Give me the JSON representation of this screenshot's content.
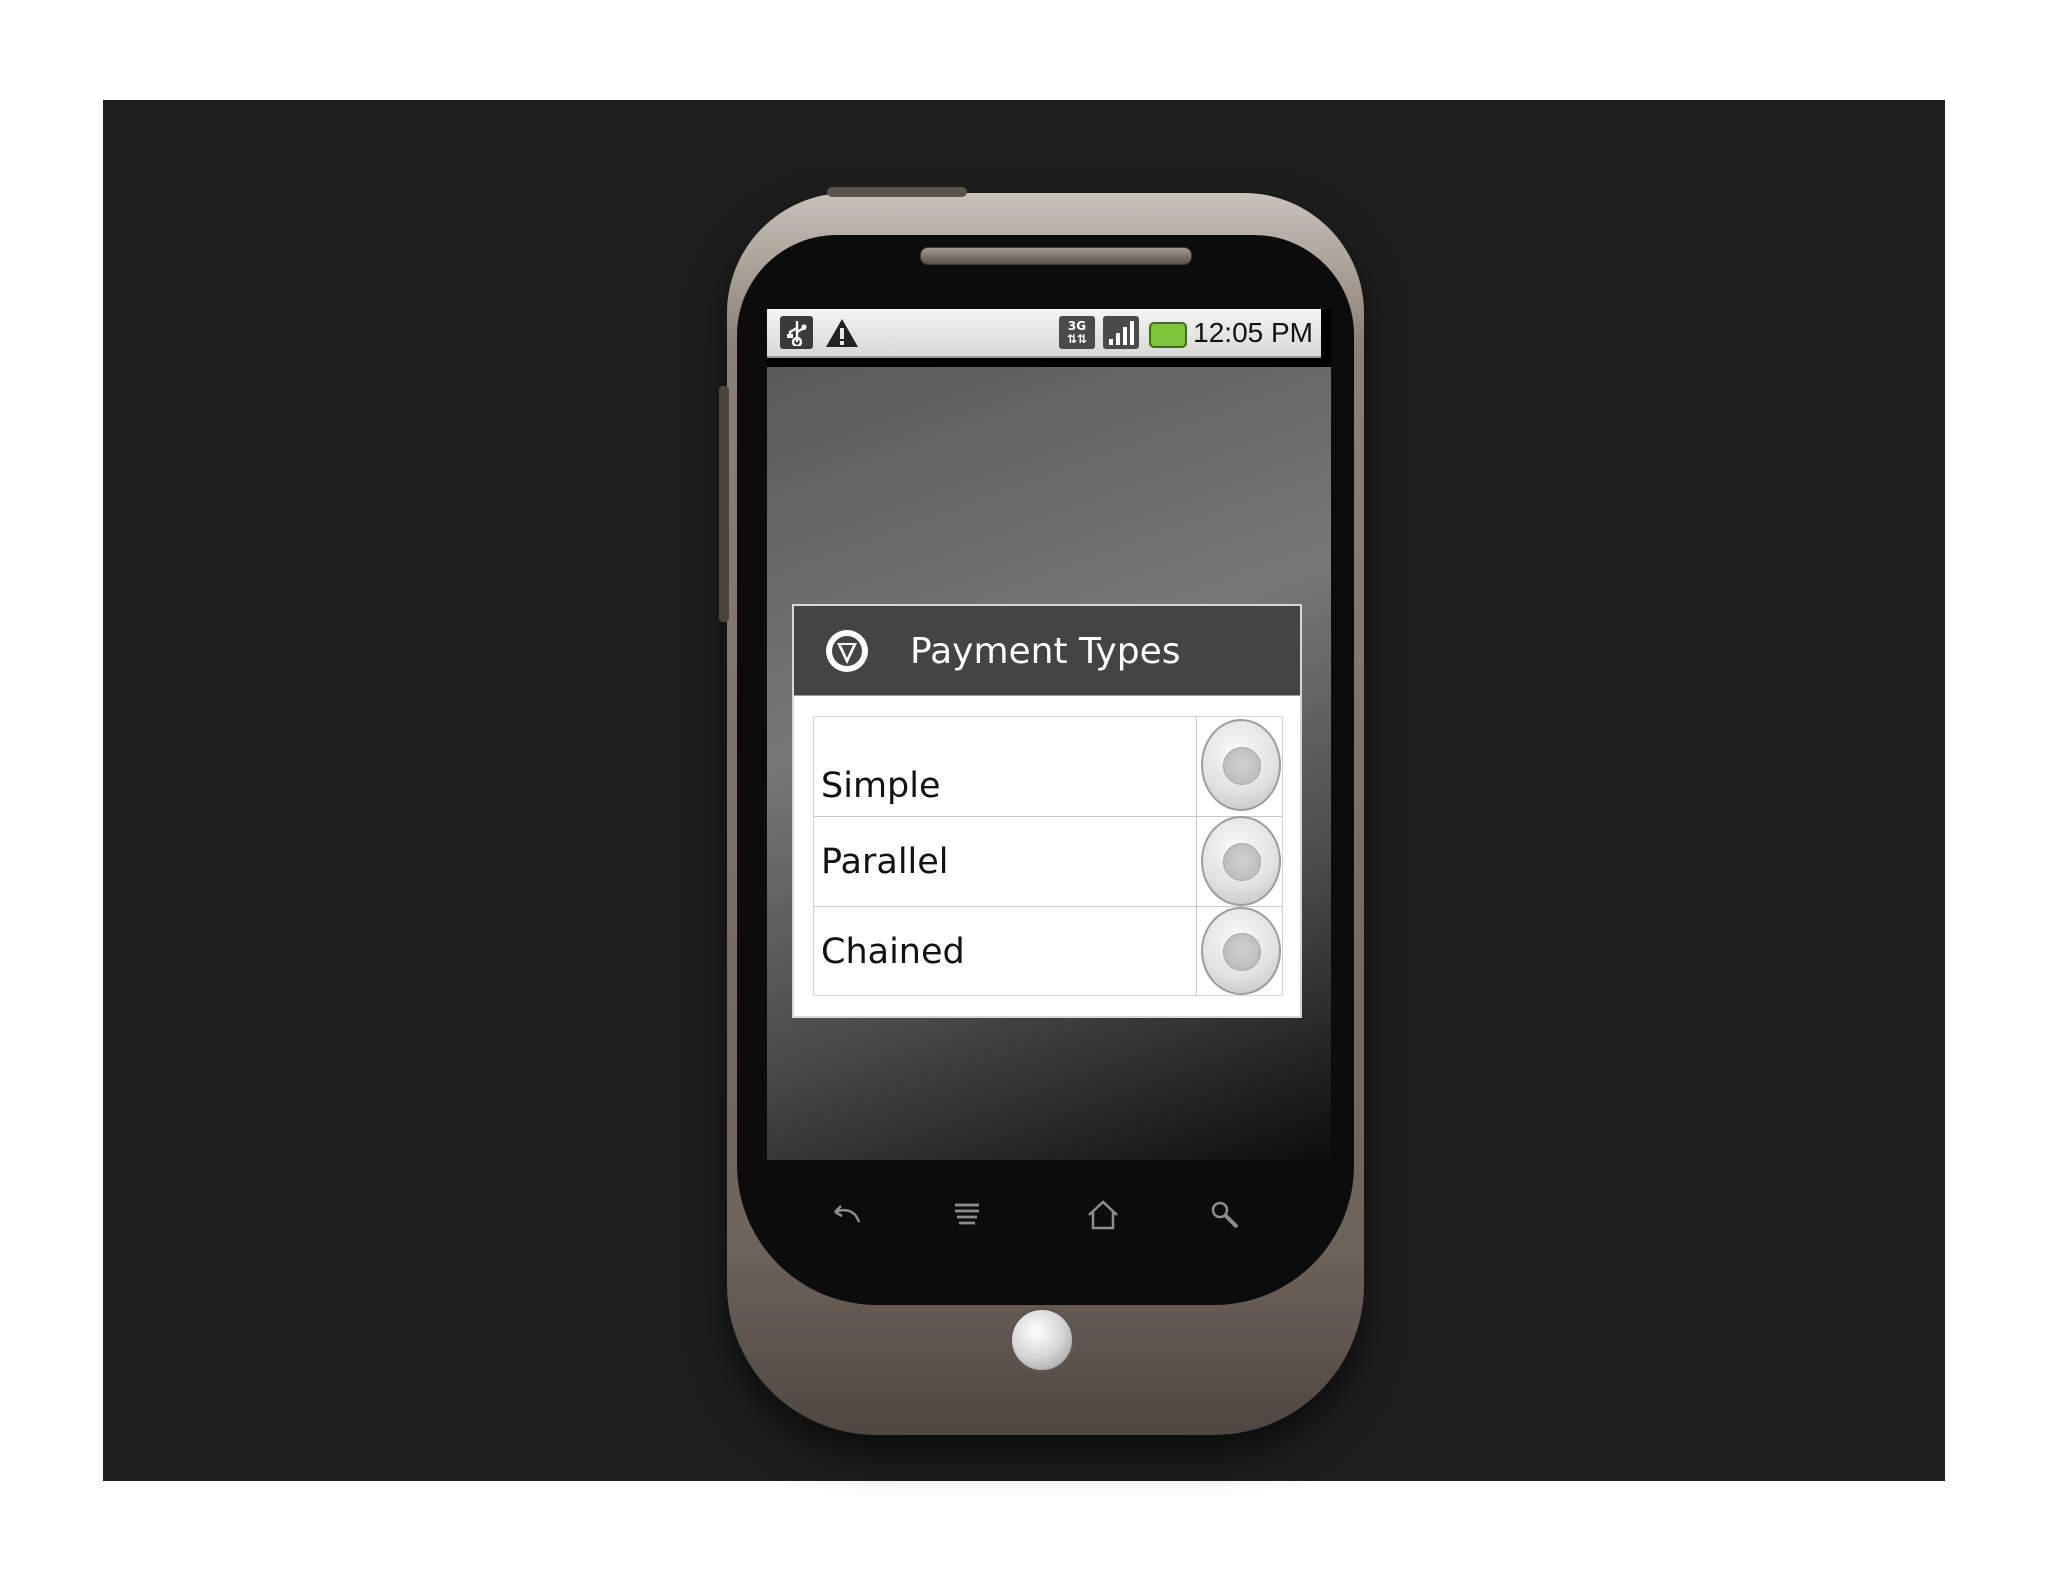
{
  "status_bar": {
    "network_label": "3G",
    "time": "12:05 PM",
    "icons": [
      "usb-icon",
      "warning-icon",
      "3g-icon",
      "signal-icon",
      "battery-icon"
    ]
  },
  "dialog": {
    "title": "Payment Types",
    "icon": "dropdown-circle-icon",
    "options": [
      {
        "label": "Simple",
        "selected": false
      },
      {
        "label": "Parallel",
        "selected": false
      },
      {
        "label": "Chained",
        "selected": false
      }
    ]
  },
  "hardware_keys": [
    "back-icon",
    "menu-icon",
    "home-icon",
    "search-icon"
  ],
  "colors": {
    "dialog_header": "#444444",
    "backdrop": "#1e1e1e",
    "battery": "#7dc43a"
  }
}
